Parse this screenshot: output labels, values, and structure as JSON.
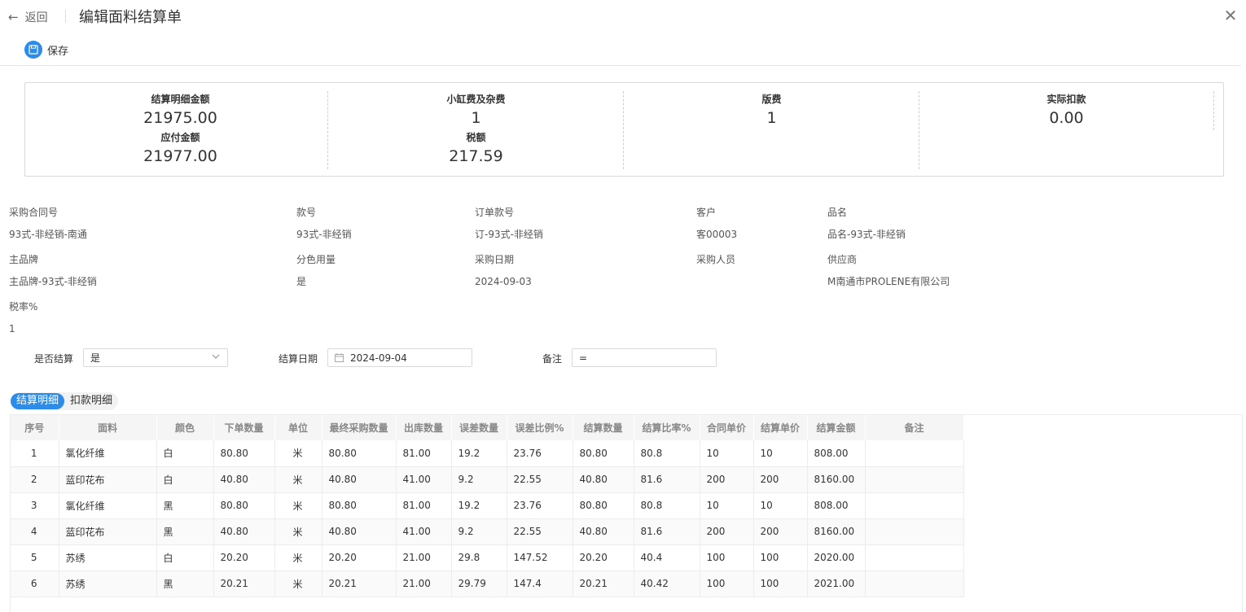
{
  "header": {
    "back_label": "返回",
    "title": "编辑面料结算单"
  },
  "toolbar": {
    "save_label": "保存"
  },
  "summary": {
    "detail_amount_label": "结算明细金额",
    "detail_amount": "21975.00",
    "small_fee_label": "小缸费及杂费",
    "small_fee": "1",
    "plate_fee_label": "版费",
    "plate_fee": "1",
    "actual_deduction_label": "实际扣款",
    "actual_deduction": "0.00",
    "payable_label": "应付金额",
    "payable": "21977.00",
    "tax_label": "税额",
    "tax": "217.59"
  },
  "info": {
    "contract_no_label": "采购合同号",
    "contract_no": "93式-非经销-南通",
    "style_no_label": "款号",
    "style_no": "93式-非经销",
    "order_style_no_label": "订单款号",
    "order_style_no": "订-93式-非经销",
    "customer_label": "客户",
    "customer": "客00003",
    "product_name_label": "品名",
    "product_name": "品名-93式-非经销",
    "brand_label": "主品牌",
    "brand": "主品牌-93式-非经销",
    "color_usage_label": "分色用量",
    "color_usage": "是",
    "purchase_date_label": "采购日期",
    "purchase_date": "2024-09-03",
    "buyer_label": "采购人员",
    "buyer": "",
    "supplier_label": "供应商",
    "supplier": "M南通市PROLENE有限公司",
    "tax_rate_label": "税率%",
    "tax_rate": "1"
  },
  "form": {
    "settled_label": "是否结算",
    "settled_value": "是",
    "settle_date_label": "结算日期",
    "settle_date_value": "2024-09-04",
    "remark_label": "备注",
    "remark_value": "="
  },
  "tabs": {
    "settlement_detail": "结算明细",
    "deduction_detail": "扣款明细"
  },
  "table": {
    "headers": [
      "序号",
      "面料",
      "颜色",
      "下单数量",
      "单位",
      "最终采购数量",
      "出库数量",
      "误差数量",
      "误差比例%",
      "结算数量",
      "结算比率%",
      "合同单价",
      "结算单价",
      "结算金额",
      "备注"
    ],
    "rows": [
      [
        "1",
        "氯化纤维",
        "白",
        "80.80",
        "米",
        "80.80",
        "81.00",
        "19.2",
        "23.76",
        "80.80",
        "80.8",
        "10",
        "10",
        "808.00",
        ""
      ],
      [
        "2",
        "蓝印花布",
        "白",
        "40.80",
        "米",
        "40.80",
        "41.00",
        "9.2",
        "22.55",
        "40.80",
        "81.6",
        "200",
        "200",
        "8160.00",
        ""
      ],
      [
        "3",
        "氯化纤维",
        "黑",
        "80.80",
        "米",
        "80.80",
        "81.00",
        "19.2",
        "23.76",
        "80.80",
        "80.8",
        "10",
        "10",
        "808.00",
        ""
      ],
      [
        "4",
        "蓝印花布",
        "黑",
        "40.80",
        "米",
        "40.80",
        "41.00",
        "9.2",
        "22.55",
        "40.80",
        "81.6",
        "200",
        "200",
        "8160.00",
        ""
      ],
      [
        "5",
        "苏绣",
        "白",
        "20.20",
        "米",
        "20.20",
        "21.00",
        "29.8",
        "147.52",
        "20.20",
        "40.4",
        "100",
        "100",
        "2020.00",
        ""
      ],
      [
        "6",
        "苏绣",
        "黑",
        "20.21",
        "米",
        "20.21",
        "21.00",
        "29.79",
        "147.4",
        "20.21",
        "40.42",
        "100",
        "100",
        "2021.00",
        ""
      ]
    ]
  },
  "colors": {
    "accent": "#2c8ce8"
  }
}
